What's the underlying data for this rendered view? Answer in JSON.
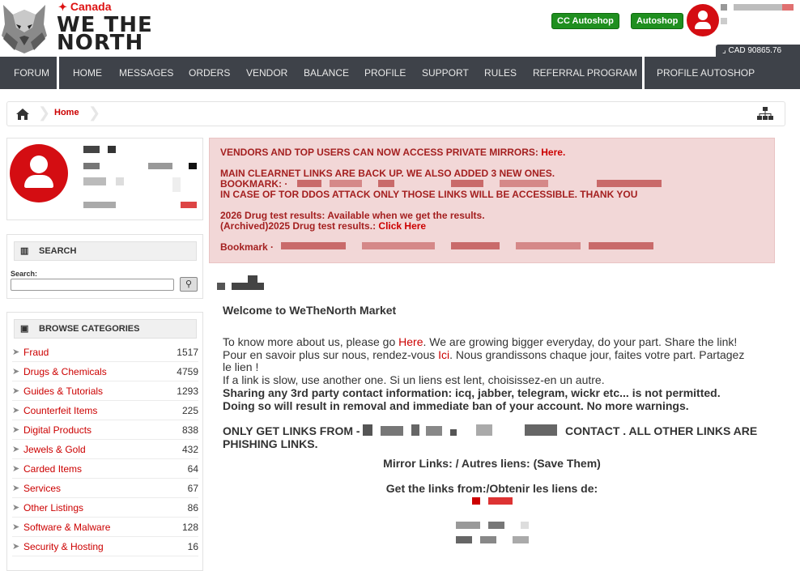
{
  "header": {
    "brand_country": "Canada",
    "brand_name_line1": "WE THE",
    "brand_name_line2": "NORTH",
    "cc_autoshop_label": "CC Autoshop",
    "autoshop_label": "Autoshop",
    "balance_text": "CAD 90865.76",
    "accent_color": "#d40d12",
    "button_color": "#1f8f1f"
  },
  "nav": {
    "items": [
      "FORUM",
      "HOME",
      "MESSAGES",
      "ORDERS",
      "VENDOR",
      "BALANCE",
      "PROFILE",
      "SUPPORT",
      "RULES",
      "REFERRAL PROGRAM",
      "PROFILE AUTOSHOP"
    ]
  },
  "breadcrumb": {
    "home_label": "Home"
  },
  "search": {
    "title": "SEARCH",
    "label": "Search:",
    "value": ""
  },
  "categories": {
    "title": "BROWSE CATEGORIES",
    "items": [
      {
        "name": "Fraud",
        "count": "1517"
      },
      {
        "name": "Drugs & Chemicals",
        "count": "4759"
      },
      {
        "name": "Guides & Tutorials",
        "count": "1293"
      },
      {
        "name": "Counterfeit Items",
        "count": "225"
      },
      {
        "name": "Digital Products",
        "count": "838"
      },
      {
        "name": "Jewels & Gold",
        "count": "432"
      },
      {
        "name": "Carded Items",
        "count": "64"
      },
      {
        "name": "Services",
        "count": "67"
      },
      {
        "name": "Other Listings",
        "count": "86"
      },
      {
        "name": "Software & Malware",
        "count": "128"
      },
      {
        "name": "Security & Hosting",
        "count": "16"
      }
    ]
  },
  "alert": {
    "line1": "VENDORS AND TOP USERS CAN NOW ACCESS PRIVATE MIRRORS: ",
    "line1_link": "Here.",
    "line2": "MAIN CLEARNET LINKS ARE BACK UP. WE ALSO ADDED 3 NEW ONES.",
    "line3": "BOOKMARK: ·",
    "line4": "IN CASE OF TOR DDOS ATTACK ONLY THOSE LINKS WILL BE ACCESSIBLE. THANK YOU",
    "line5": "2026 Drug test results: Available when we get the results.",
    "line6": "(Archived)2025 Drug test results.: ",
    "line6_link": "Click Here",
    "line7": "Bookmark ·"
  },
  "main": {
    "welcome": "Welcome to WeTheNorth Market",
    "p1a": "To know more about us, please go ",
    "p1_link": "Here",
    "p1b": ". We are growing bigger everyday, do your part. Share the link!",
    "p2a": "Pour en savoir plus sur nous, rendez-vous ",
    "p2_link": "Ici",
    "p2b": ". Nous grandissons chaque jour, faites votre part. Partagez",
    "p2c": "le lien !",
    "p3": "If a link is slow, use another one. Si un liens est lent, choisissez-en un autre.",
    "p4": "Sharing any 3rd party contact information: icq, jabber, telegram, wickr etc... is not permitted.",
    "p5": "Doing so will result in removal and immediate ban of your account. No more warnings.",
    "p6a": "ONLY GET LINKS FROM -",
    "p6b": "CONTACT . ALL OTHER LINKS ARE",
    "p6c": "PHISHING LINKS.",
    "mirror": "Mirror Links: / Autres liens: (Save Them)",
    "getlinks": "Get the links from:/Obtenir les liens de:"
  }
}
